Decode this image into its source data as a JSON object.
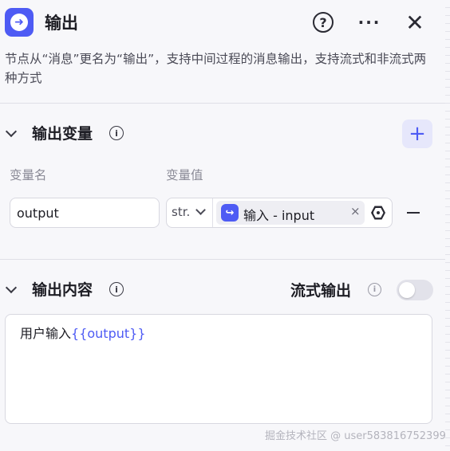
{
  "header": {
    "node_icon": "output-arrow-icon",
    "title": "输出",
    "help_glyph": "?",
    "more_glyph": "···",
    "close_glyph": "✕"
  },
  "description": "节点从“消息”更名为“输出”，支持中间过程的消息输出，支持流式和非流式两种方式",
  "output_variables": {
    "title": "输出变量",
    "info_glyph": "i",
    "add_glyph": "+",
    "col_name": "变量名",
    "col_value": "变量值",
    "rows": [
      {
        "name": "output",
        "type": "str.",
        "ref_icon_glyph": "↪",
        "ref_label": "输入 - input",
        "ref_remove_glyph": "×"
      }
    ]
  },
  "output_content": {
    "title": "输出内容",
    "info_glyph": "i",
    "stream_label": "流式输出",
    "stream_info_glyph": "i",
    "stream_enabled": false,
    "text_prefix": "用户输入",
    "text_variable": "{{output}}"
  },
  "watermark": "掘金技术社区 @ user5838167523996",
  "colors": {
    "accent": "#4e5bf4",
    "background": "#f7f7fa",
    "toggle_off": "#e2e2ea"
  }
}
